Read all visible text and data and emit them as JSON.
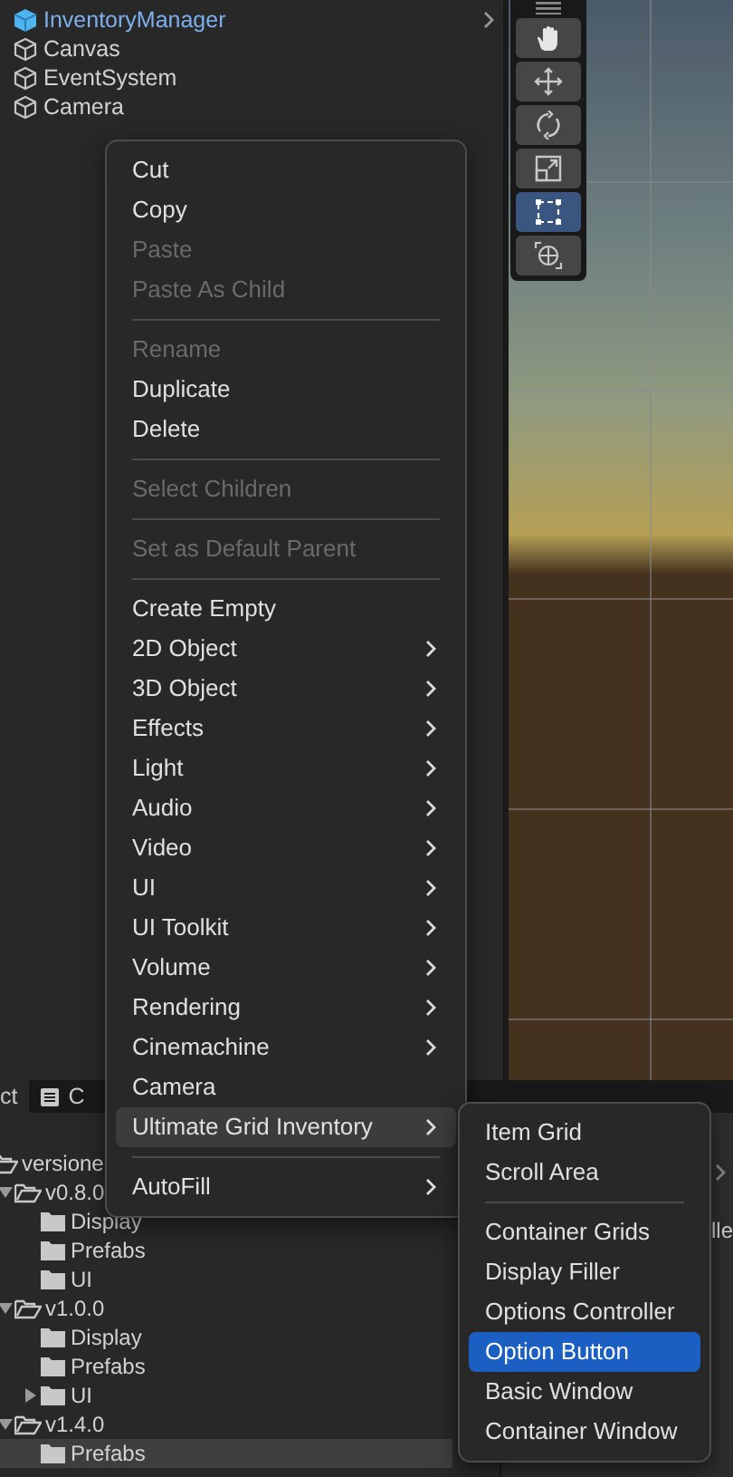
{
  "hierarchy": {
    "items": [
      {
        "label": "InventoryManager",
        "kind": "prefab",
        "selected": true
      },
      {
        "label": "Canvas",
        "kind": "object",
        "selected": false
      },
      {
        "label": "EventSystem",
        "kind": "object",
        "selected": false
      },
      {
        "label": "Camera",
        "kind": "object",
        "selected": false
      }
    ]
  },
  "scene_tools": [
    {
      "kind": "hand",
      "selected": false
    },
    {
      "kind": "move",
      "selected": false
    },
    {
      "kind": "rotate",
      "selected": false
    },
    {
      "kind": "scale",
      "selected": false
    },
    {
      "kind": "rect",
      "selected": true
    },
    {
      "kind": "transform",
      "selected": false
    }
  ],
  "context_menu": {
    "items": [
      {
        "kind": "item",
        "label": "Cut",
        "disabled": false,
        "submenu": false,
        "selected": false
      },
      {
        "kind": "item",
        "label": "Copy",
        "disabled": false,
        "submenu": false,
        "selected": false
      },
      {
        "kind": "item",
        "label": "Paste",
        "disabled": true,
        "submenu": false,
        "selected": false
      },
      {
        "kind": "item",
        "label": "Paste As Child",
        "disabled": true,
        "submenu": false,
        "selected": false
      },
      {
        "kind": "separator"
      },
      {
        "kind": "item",
        "label": "Rename",
        "disabled": true,
        "submenu": false,
        "selected": false
      },
      {
        "kind": "item",
        "label": "Duplicate",
        "disabled": false,
        "submenu": false,
        "selected": false
      },
      {
        "kind": "item",
        "label": "Delete",
        "disabled": false,
        "submenu": false,
        "selected": false
      },
      {
        "kind": "separator"
      },
      {
        "kind": "item",
        "label": "Select Children",
        "disabled": true,
        "submenu": false,
        "selected": false
      },
      {
        "kind": "separator"
      },
      {
        "kind": "item",
        "label": "Set as Default Parent",
        "disabled": true,
        "submenu": false,
        "selected": false
      },
      {
        "kind": "separator"
      },
      {
        "kind": "item",
        "label": "Create Empty",
        "disabled": false,
        "submenu": false,
        "selected": false
      },
      {
        "kind": "item",
        "label": "2D Object",
        "disabled": false,
        "submenu": true,
        "selected": false
      },
      {
        "kind": "item",
        "label": "3D Object",
        "disabled": false,
        "submenu": true,
        "selected": false
      },
      {
        "kind": "item",
        "label": "Effects",
        "disabled": false,
        "submenu": true,
        "selected": false
      },
      {
        "kind": "item",
        "label": "Light",
        "disabled": false,
        "submenu": true,
        "selected": false
      },
      {
        "kind": "item",
        "label": "Audio",
        "disabled": false,
        "submenu": true,
        "selected": false
      },
      {
        "kind": "item",
        "label": "Video",
        "disabled": false,
        "submenu": true,
        "selected": false
      },
      {
        "kind": "item",
        "label": "UI",
        "disabled": false,
        "submenu": true,
        "selected": false
      },
      {
        "kind": "item",
        "label": "UI Toolkit",
        "disabled": false,
        "submenu": true,
        "selected": false
      },
      {
        "kind": "item",
        "label": "Volume",
        "disabled": false,
        "submenu": true,
        "selected": false
      },
      {
        "kind": "item",
        "label": "Rendering",
        "disabled": false,
        "submenu": true,
        "selected": false
      },
      {
        "kind": "item",
        "label": "Cinemachine",
        "disabled": false,
        "submenu": true,
        "selected": false
      },
      {
        "kind": "item",
        "label": "Camera",
        "disabled": false,
        "submenu": false,
        "selected": false
      },
      {
        "kind": "item",
        "label": "Ultimate Grid Inventory",
        "disabled": false,
        "submenu": true,
        "selected": true
      },
      {
        "kind": "separator"
      },
      {
        "kind": "item",
        "label": "AutoFill",
        "disabled": false,
        "submenu": true,
        "selected": false
      }
    ]
  },
  "submenu": {
    "items": [
      {
        "kind": "item",
        "label": "Item Grid",
        "selected": false
      },
      {
        "kind": "item",
        "label": "Scroll Area",
        "selected": false
      },
      {
        "kind": "separator"
      },
      {
        "kind": "item",
        "label": "Container Grids",
        "selected": false
      },
      {
        "kind": "item",
        "label": "Display Filler",
        "selected": false
      },
      {
        "kind": "item",
        "label": "Options Controller",
        "selected": false
      },
      {
        "kind": "item",
        "label": "Option Button",
        "selected": true
      },
      {
        "kind": "item",
        "label": "Basic Window",
        "selected": false
      },
      {
        "kind": "item",
        "label": "Container Window",
        "selected": false
      }
    ]
  },
  "project_panel": {
    "tabs": [
      {
        "label": "ct",
        "selected": true
      },
      {
        "label": "C",
        "selected": false
      }
    ],
    "tree": [
      {
        "label": "versione",
        "selected": false,
        "children": [
          {
            "label": "v0.8.0",
            "expanded": true,
            "selected": false,
            "children": [
              {
                "label": "Display",
                "selected": false
              },
              {
                "label": "Prefabs",
                "selected": false
              },
              {
                "label": "UI",
                "selected": false
              }
            ]
          },
          {
            "label": "v1.0.0",
            "expanded": true,
            "selected": false,
            "children": [
              {
                "label": "Display",
                "selected": false
              },
              {
                "label": "Prefabs",
                "selected": false
              },
              {
                "label": "UI",
                "expanded": false,
                "selected": false
              }
            ]
          },
          {
            "label": "v1.4.0",
            "expanded": true,
            "selected": false,
            "children": [
              {
                "label": "Prefabs",
                "selected": true
              }
            ]
          }
        ]
      }
    ],
    "column_2": {
      "text": "lle"
    }
  }
}
